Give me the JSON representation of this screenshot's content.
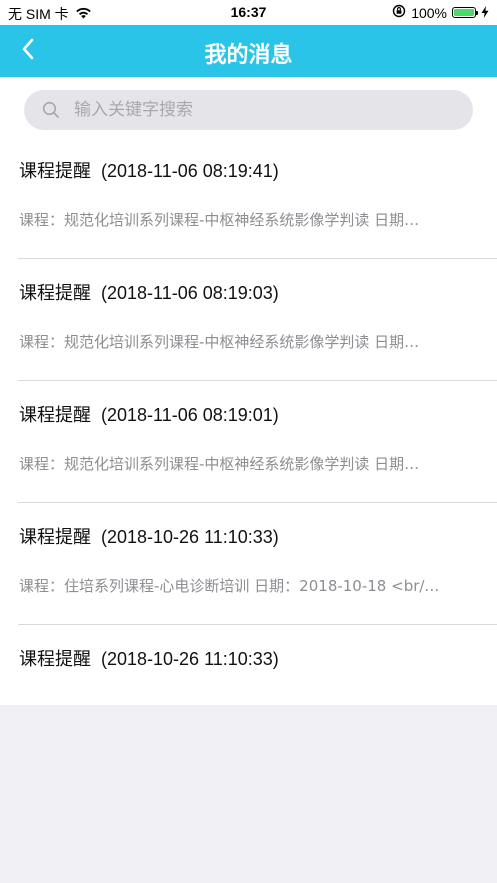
{
  "status_bar": {
    "carrier": "无 SIM 卡",
    "time": "16:37",
    "battery": "100%",
    "battery_level": 1.0
  },
  "nav": {
    "title": "我的消息",
    "back_icon": "chevron-left-icon"
  },
  "search": {
    "placeholder": "输入关键字搜索",
    "value": ""
  },
  "colors": {
    "accent": "#29c4e7",
    "background": "#efeff4",
    "preview_text": "#8e8e93"
  },
  "messages": [
    {
      "title": "课程提醒",
      "time": "(2018-11-06 08:19:41)",
      "preview": "课程：规范化培训系列课程-中枢神经系统影像学判读 日期…"
    },
    {
      "title": "课程提醒",
      "time": "(2018-11-06 08:19:03)",
      "preview": "课程：规范化培训系列课程-中枢神经系统影像学判读 日期…"
    },
    {
      "title": "课程提醒",
      "time": "(2018-11-06 08:19:01)",
      "preview": "课程：规范化培训系列课程-中枢神经系统影像学判读 日期…"
    },
    {
      "title": "课程提醒",
      "time": "(2018-10-26 11:10:33)",
      "preview": "课程：住培系列课程-心电诊断培训 日期：2018-10-18 <br/…"
    },
    {
      "title": "课程提醒",
      "time": "(2018-10-26 11:10:33)"
    }
  ]
}
